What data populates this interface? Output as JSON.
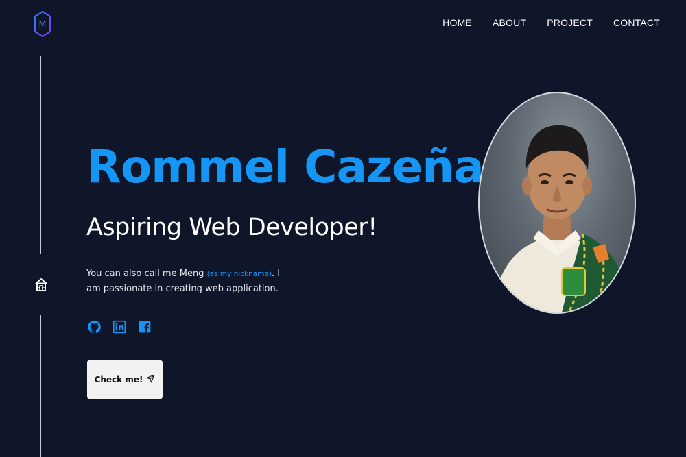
{
  "logo": {
    "letter": "M",
    "colors": [
      "#2f7cf6",
      "#7b3df0"
    ]
  },
  "nav": {
    "items": [
      {
        "label": "HOME"
      },
      {
        "label": "ABOUT"
      },
      {
        "label": "PROJECT"
      },
      {
        "label": "CONTACT"
      }
    ]
  },
  "sidebar": {
    "icon": "home-icon"
  },
  "hero": {
    "name": "Rommel Cazeñas",
    "role": "Aspiring Web Developer!",
    "description_prefix": "You can also call me Meng ",
    "nickname_note": "(as my nickname)",
    "description_suffix": ". I am passionate in creating web application.",
    "socials": [
      {
        "icon": "github-icon"
      },
      {
        "icon": "linkedin-icon"
      },
      {
        "icon": "facebook-icon"
      }
    ],
    "cta_label": "Check me!",
    "cta_icon": "send-icon"
  },
  "portrait": {
    "alt": "profile-photo"
  },
  "colors": {
    "background": "#0f1629",
    "accent": "#1596f5",
    "text": "#ffffff",
    "button_bg": "#f2f2f2"
  }
}
